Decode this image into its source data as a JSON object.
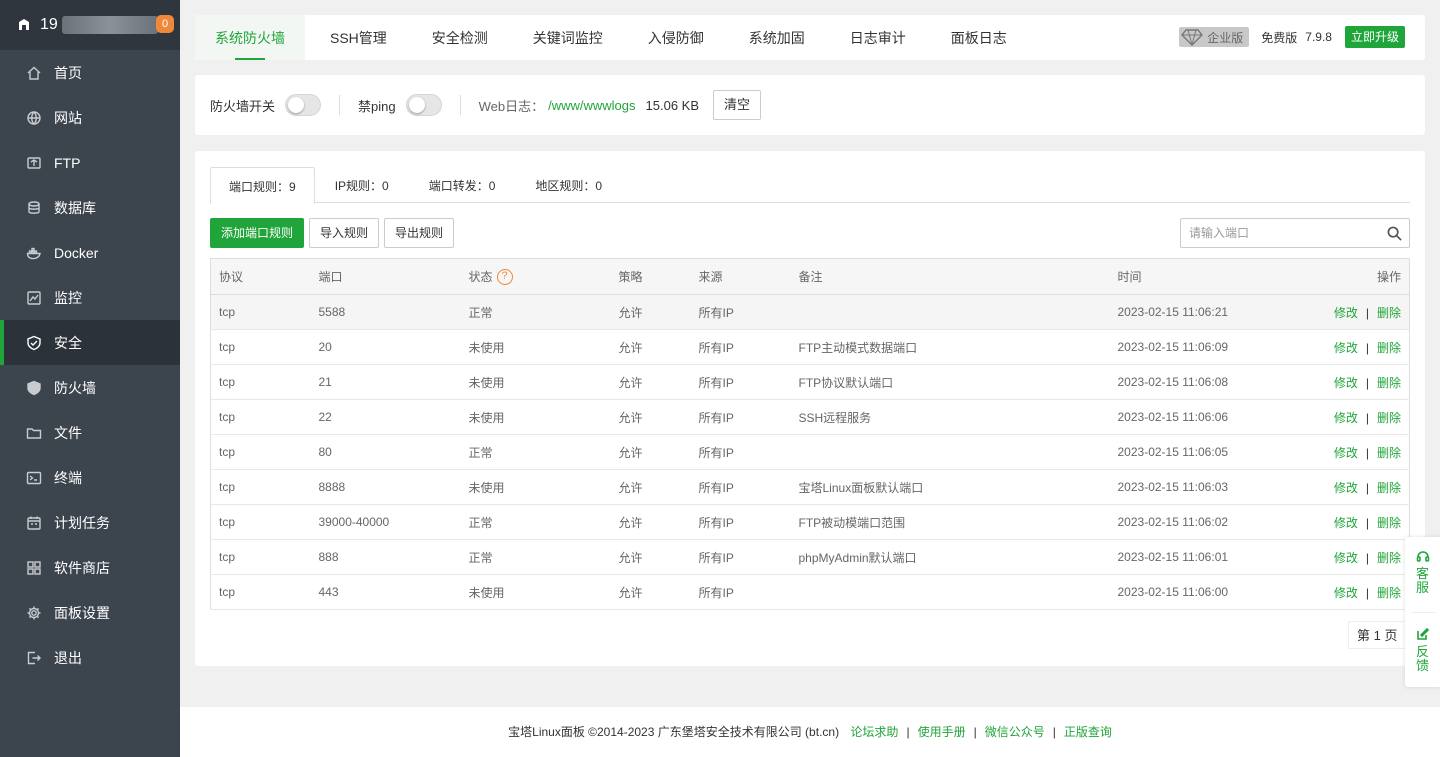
{
  "sidebar": {
    "server_ip_prefix": "19",
    "badge": "0",
    "items": [
      {
        "label": "首页",
        "icon": "home-icon",
        "active": false
      },
      {
        "label": "网站",
        "icon": "globe-icon",
        "active": false
      },
      {
        "label": "FTP",
        "icon": "ftp-icon",
        "active": false
      },
      {
        "label": "数据库",
        "icon": "database-icon",
        "active": false
      },
      {
        "label": "Docker",
        "icon": "docker-icon",
        "active": false
      },
      {
        "label": "监控",
        "icon": "monitor-icon",
        "active": false
      },
      {
        "label": "安全",
        "icon": "shield-check-icon",
        "active": true
      },
      {
        "label": "防火墙",
        "icon": "shield-icon",
        "active": false
      },
      {
        "label": "文件",
        "icon": "folder-icon",
        "active": false
      },
      {
        "label": "终端",
        "icon": "terminal-icon",
        "active": false
      },
      {
        "label": "计划任务",
        "icon": "calendar-icon",
        "active": false
      },
      {
        "label": "软件商店",
        "icon": "apps-icon",
        "active": false
      },
      {
        "label": "面板设置",
        "icon": "gear-icon",
        "active": false
      },
      {
        "label": "退出",
        "icon": "logout-icon",
        "active": false
      }
    ]
  },
  "topnav": {
    "tabs": [
      "系统防火墙",
      "SSH管理",
      "安全检测",
      "关键词监控",
      "入侵防御",
      "系统加固",
      "日志审计",
      "面板日志"
    ],
    "active_index": 0,
    "enterprise_label": "企业版",
    "free_label": "免费版",
    "version": "7.9.8",
    "upgrade_label": "立即升级"
  },
  "toolbar": {
    "firewall_switch_label": "防火墙开关",
    "firewall_on": false,
    "ping_label": "禁ping",
    "ping_on": false,
    "weblog_label": "Web日志：",
    "weblog_path": "/www/wwwlogs",
    "weblog_size": "15.06 KB",
    "clear_label": "清空"
  },
  "subtabs": [
    "端口规则：9",
    "IP规则：0",
    "端口转发：0",
    "地区规则：0"
  ],
  "actions": {
    "add_label": "添加端口规则",
    "import_label": "导入规则",
    "export_label": "导出规则"
  },
  "search": {
    "placeholder": "请输入端口"
  },
  "table": {
    "headers": {
      "protocol": "协议",
      "port": "端口",
      "status": "状态",
      "policy": "策略",
      "source": "来源",
      "remark": "备注",
      "time": "时间",
      "ops": "操作"
    },
    "status_help": "?",
    "edit_label": "修改",
    "delete_label": "删除",
    "rows": [
      {
        "protocol": "tcp",
        "port": "5588",
        "status": "正常",
        "policy": "允许",
        "source": "所有IP",
        "remark": "",
        "time": "2023-02-15 11:06:21"
      },
      {
        "protocol": "tcp",
        "port": "20",
        "status": "未使用",
        "policy": "允许",
        "source": "所有IP",
        "remark": "FTP主动模式数据端口",
        "time": "2023-02-15 11:06:09"
      },
      {
        "protocol": "tcp",
        "port": "21",
        "status": "未使用",
        "policy": "允许",
        "source": "所有IP",
        "remark": "FTP协议默认端口",
        "time": "2023-02-15 11:06:08"
      },
      {
        "protocol": "tcp",
        "port": "22",
        "status": "未使用",
        "policy": "允许",
        "source": "所有IP",
        "remark": "SSH远程服务",
        "time": "2023-02-15 11:06:06"
      },
      {
        "protocol": "tcp",
        "port": "80",
        "status": "正常",
        "policy": "允许",
        "source": "所有IP",
        "remark": "",
        "time": "2023-02-15 11:06:05"
      },
      {
        "protocol": "tcp",
        "port": "8888",
        "status": "未使用",
        "policy": "允许",
        "source": "所有IP",
        "remark": "宝塔Linux面板默认端口",
        "time": "2023-02-15 11:06:03"
      },
      {
        "protocol": "tcp",
        "port": "39000-40000",
        "status": "正常",
        "policy": "允许",
        "source": "所有IP",
        "remark": "FTP被动模端口范围",
        "time": "2023-02-15 11:06:02"
      },
      {
        "protocol": "tcp",
        "port": "888",
        "status": "正常",
        "policy": "允许",
        "source": "所有IP",
        "remark": "phpMyAdmin默认端口",
        "time": "2023-02-15 11:06:01"
      },
      {
        "protocol": "tcp",
        "port": "443",
        "status": "未使用",
        "policy": "允许",
        "source": "所有IP",
        "remark": "",
        "time": "2023-02-15 11:06:00"
      }
    ]
  },
  "pager": {
    "label": "第 1 页"
  },
  "float": {
    "service_label": "客服",
    "feedback_label": "反馈"
  },
  "footer": {
    "copyright": "宝塔Linux面板 ©2014-2023 广东堡塔安全技术有限公司 (bt.cn)",
    "links": [
      "论坛求助",
      "使用手册",
      "微信公众号",
      "正版查询"
    ]
  },
  "colors": {
    "accent": "#20a53a",
    "sidebar_bg": "#3c444d",
    "warning": "#f0883a"
  }
}
